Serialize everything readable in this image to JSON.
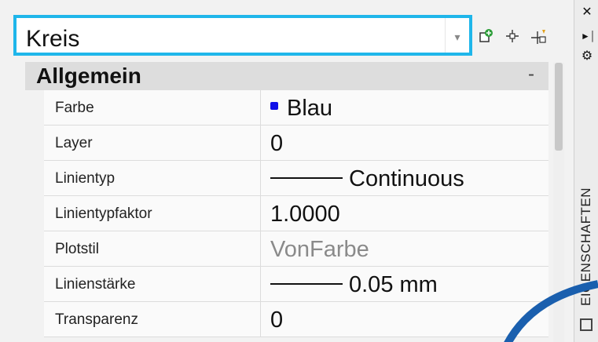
{
  "selector": {
    "value": "Kreis"
  },
  "toolbar": {
    "icons": [
      "quick-select-icon",
      "select-objects-icon",
      "toggle-pickadd-icon"
    ]
  },
  "section": {
    "title": "Allgemein",
    "collapse_glyph": "-"
  },
  "properties": [
    {
      "name": "Farbe",
      "value": "Blau"
    },
    {
      "name": "Layer",
      "value": "0"
    },
    {
      "name": "Linientyp",
      "value": "Continuous"
    },
    {
      "name": "Linientypfaktor",
      "value": "1.0000"
    },
    {
      "name": "Plotstil",
      "value": "VonFarbe"
    },
    {
      "name": "Linienstärke",
      "value": "0.05 mm"
    },
    {
      "name": "Transparenz",
      "value": "0"
    }
  ],
  "palette": {
    "vertical_title": "EIGENSCHAFTEN"
  },
  "colors": {
    "highlight": "#1fb6ea",
    "swatch_blue": "#1010e8",
    "arc_blue": "#1a5fae"
  }
}
